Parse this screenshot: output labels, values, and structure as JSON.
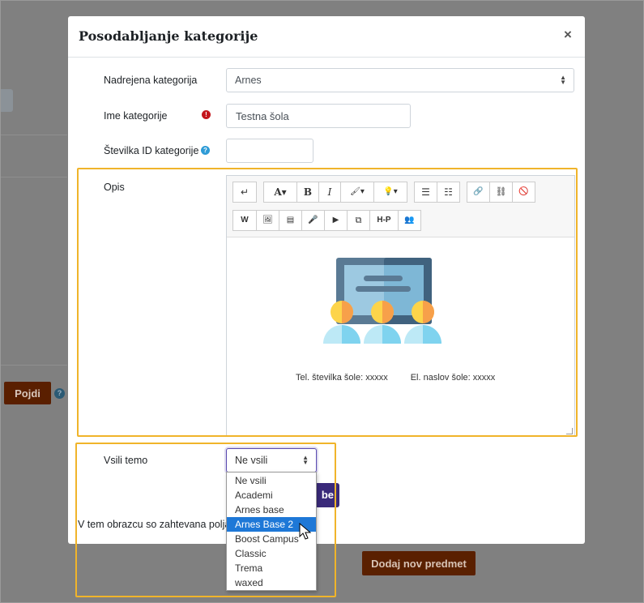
{
  "background": {
    "go_button": "Pojdi",
    "help_icon": "?",
    "add_course_button": "Dodaj nov predmet"
  },
  "modal": {
    "title": "Posodabljanje kategorije",
    "close_label": "×",
    "fields": {
      "parent_label": "Nadrejena kategorija",
      "parent_value": "Arnes",
      "name_label": "Ime kategorije",
      "name_value": "Testna šola",
      "required_icon": "!",
      "id_label": "Številka ID kategorije",
      "id_help_icon": "?",
      "id_value": "",
      "description_label": "Opis",
      "theme_label": "Vsili temo",
      "theme_value": "Ne vsili"
    },
    "editor": {
      "toolbar_row1": [
        "↵",
        "A▾",
        "B",
        "I",
        "🖌▾",
        "💡▾",
        "☰",
        "☷",
        "🔗",
        "⛓",
        "🚫"
      ],
      "toolbar_row2": [
        "W",
        "🖼",
        "▤",
        "🎤",
        "▶",
        "⧉",
        "H-P",
        "👥"
      ],
      "contact_phone": "Tel. številka šole:  xxxxx",
      "contact_email": "El. naslov šole: xxxxx"
    },
    "save_button_fragment": "be",
    "required_note": "V tem obrazcu so zahtevana polja o"
  },
  "theme_dropdown": {
    "options": [
      "Ne vsili",
      "Academi",
      "Arnes base",
      "Arnes Base 2",
      "Boost Campus",
      "Classic",
      "Trema",
      "waxed"
    ],
    "selected_index": 3
  },
  "colors": {
    "accent": "#3a2a7a",
    "highlight": "#f0b42a",
    "selected_option": "#1e78d7",
    "brand_button": "#5a2000"
  }
}
